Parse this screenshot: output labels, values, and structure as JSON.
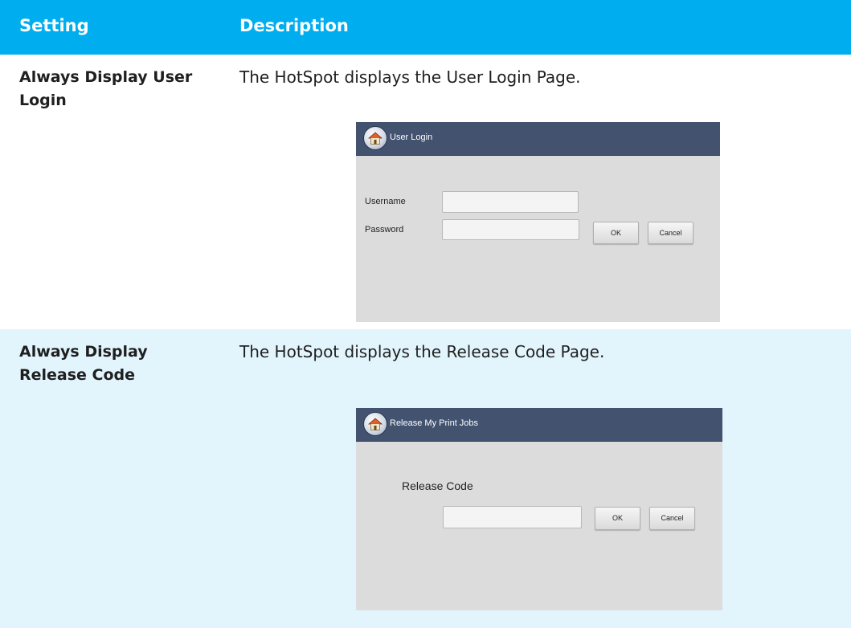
{
  "table": {
    "headers": {
      "setting": "Setting",
      "description": "Description"
    },
    "rows": [
      {
        "setting": "Always Display User Login",
        "description": "The HotSpot displays the User Login Page.",
        "screen": {
          "title": "User Login",
          "username_label": "Username",
          "password_label": "Password",
          "ok": "OK",
          "cancel": "Cancel"
        }
      },
      {
        "setting": "Always Display Release Code",
        "description": "The HotSpot displays the Release Code Page.",
        "screen": {
          "title": "Release My Print Jobs",
          "code_label": "Release Code",
          "ok": "OK",
          "cancel": "Cancel"
        }
      }
    ]
  },
  "icons": {
    "home": "home-icon"
  },
  "colors": {
    "header": "#00adef",
    "row_alt": "#e2f5fd",
    "titlebar": "#42526f"
  }
}
